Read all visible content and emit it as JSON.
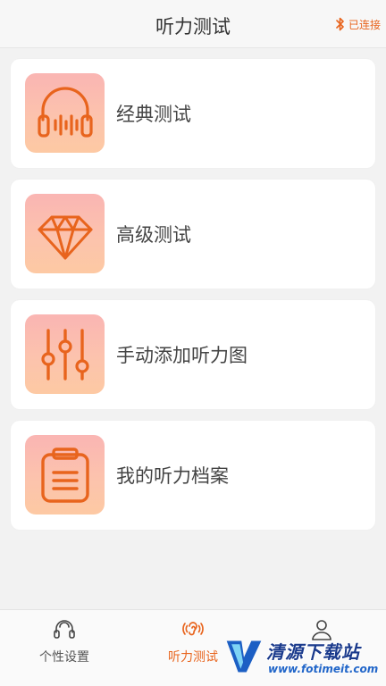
{
  "header": {
    "title": "听力测试",
    "bluetooth_status": "已连接",
    "bluetooth_icon": "bluetooth-icon"
  },
  "cards": [
    {
      "label": "经典测试",
      "icon": "headphones-icon"
    },
    {
      "label": "高级测试",
      "icon": "diamond-icon"
    },
    {
      "label": "手动添加听力图",
      "icon": "sliders-icon"
    },
    {
      "label": "我的听力档案",
      "icon": "clipboard-icon"
    }
  ],
  "tabbar": {
    "items": [
      {
        "label": "个性设置",
        "icon": "headset-icon",
        "active": false
      },
      {
        "label": "听力测试",
        "icon": "ear-icon",
        "active": true
      },
      {
        "label": "",
        "icon": "user-icon",
        "active": false
      }
    ]
  },
  "watermark": {
    "text": "清源下载站",
    "url": "www.fotimeit.com"
  },
  "colors": {
    "accent": "#e8641d",
    "icon_bg_top": "#fab5b3",
    "icon_bg_bottom": "#fdc9a3",
    "background": "#f2f2f2"
  }
}
